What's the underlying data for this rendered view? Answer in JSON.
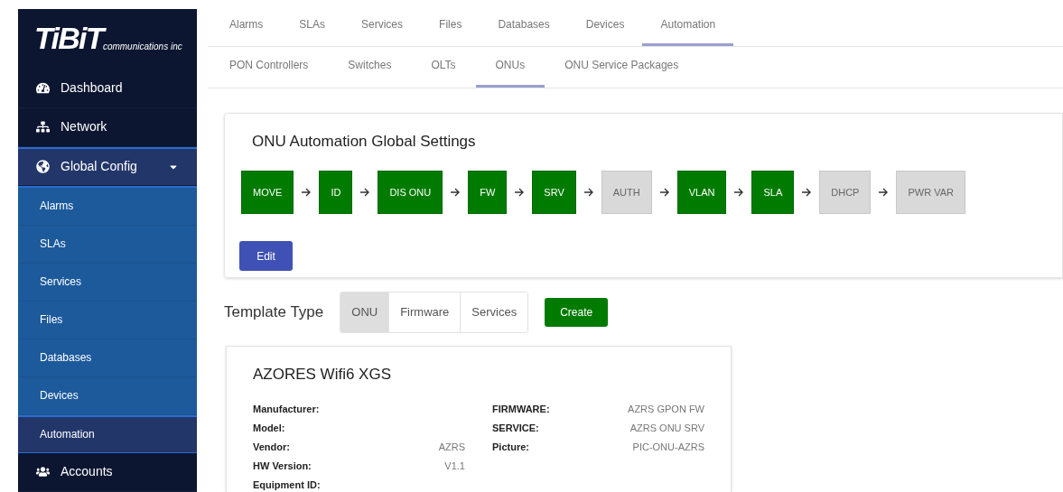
{
  "logo": {
    "brand": "TiBiT",
    "tagline": "communications inc"
  },
  "sidebar": {
    "items": [
      {
        "label": "Dashboard",
        "kind": "gauge"
      },
      {
        "label": "Network",
        "kind": "network"
      },
      {
        "label": "Global Config",
        "kind": "globe",
        "expanded": true,
        "children": [
          {
            "label": "Alarms",
            "selected": false
          },
          {
            "label": "SLAs",
            "selected": false
          },
          {
            "label": "Services",
            "selected": false
          },
          {
            "label": "Files",
            "selected": false
          },
          {
            "label": "Databases",
            "selected": false
          },
          {
            "label": "Devices",
            "selected": false
          },
          {
            "label": "Automation",
            "selected": true
          }
        ]
      },
      {
        "label": "Accounts",
        "kind": "users"
      }
    ]
  },
  "tabs": [
    {
      "label": "Alarms",
      "selected": false
    },
    {
      "label": "SLAs",
      "selected": false
    },
    {
      "label": "Services",
      "selected": false
    },
    {
      "label": "Files",
      "selected": false
    },
    {
      "label": "Databases",
      "selected": false
    },
    {
      "label": "Devices",
      "selected": false
    },
    {
      "label": "Automation",
      "selected": true
    }
  ],
  "subtabs": [
    {
      "label": "PON Controllers",
      "selected": false
    },
    {
      "label": "Switches",
      "selected": false
    },
    {
      "label": "OLTs",
      "selected": false
    },
    {
      "label": "ONUs",
      "selected": true
    },
    {
      "label": "ONU Service Packages",
      "selected": false
    }
  ],
  "global_settings": {
    "title": "ONU Automation Global Settings",
    "steps": [
      {
        "label": "MOVE",
        "enabled": true
      },
      {
        "label": "ID",
        "enabled": true
      },
      {
        "label": "DIS ONU",
        "enabled": true
      },
      {
        "label": "FW",
        "enabled": true
      },
      {
        "label": "SRV",
        "enabled": true
      },
      {
        "label": "AUTH",
        "enabled": false
      },
      {
        "label": "VLAN",
        "enabled": true
      },
      {
        "label": "SLA",
        "enabled": true
      },
      {
        "label": "DHCP",
        "enabled": false
      },
      {
        "label": "PWR VAR",
        "enabled": false
      }
    ],
    "edit_button": "Edit"
  },
  "template_type": {
    "label": "Template Type",
    "options": [
      {
        "label": "ONU",
        "selected": true
      },
      {
        "label": "Firmware",
        "selected": false
      },
      {
        "label": "Services",
        "selected": false
      }
    ],
    "create_button": "Create"
  },
  "template_card": {
    "title": "AZORES Wifi6 XGS",
    "left_fields": [
      {
        "label": "Manufacturer:"
      },
      {
        "label": "Model:"
      },
      {
        "label": "Vendor:",
        "value": "AZRS"
      },
      {
        "label": "HW Version:",
        "value": "V1.1"
      },
      {
        "label": "Equipment ID:"
      }
    ],
    "right_fields": [
      {
        "label": "FIRMWARE:",
        "value": "AZRS GPON FW"
      },
      {
        "label": "SERVICE:",
        "value": "AZRS ONU SRV"
      },
      {
        "label": "Picture:",
        "value": "PIC-ONU-AZRS"
      }
    ]
  }
}
